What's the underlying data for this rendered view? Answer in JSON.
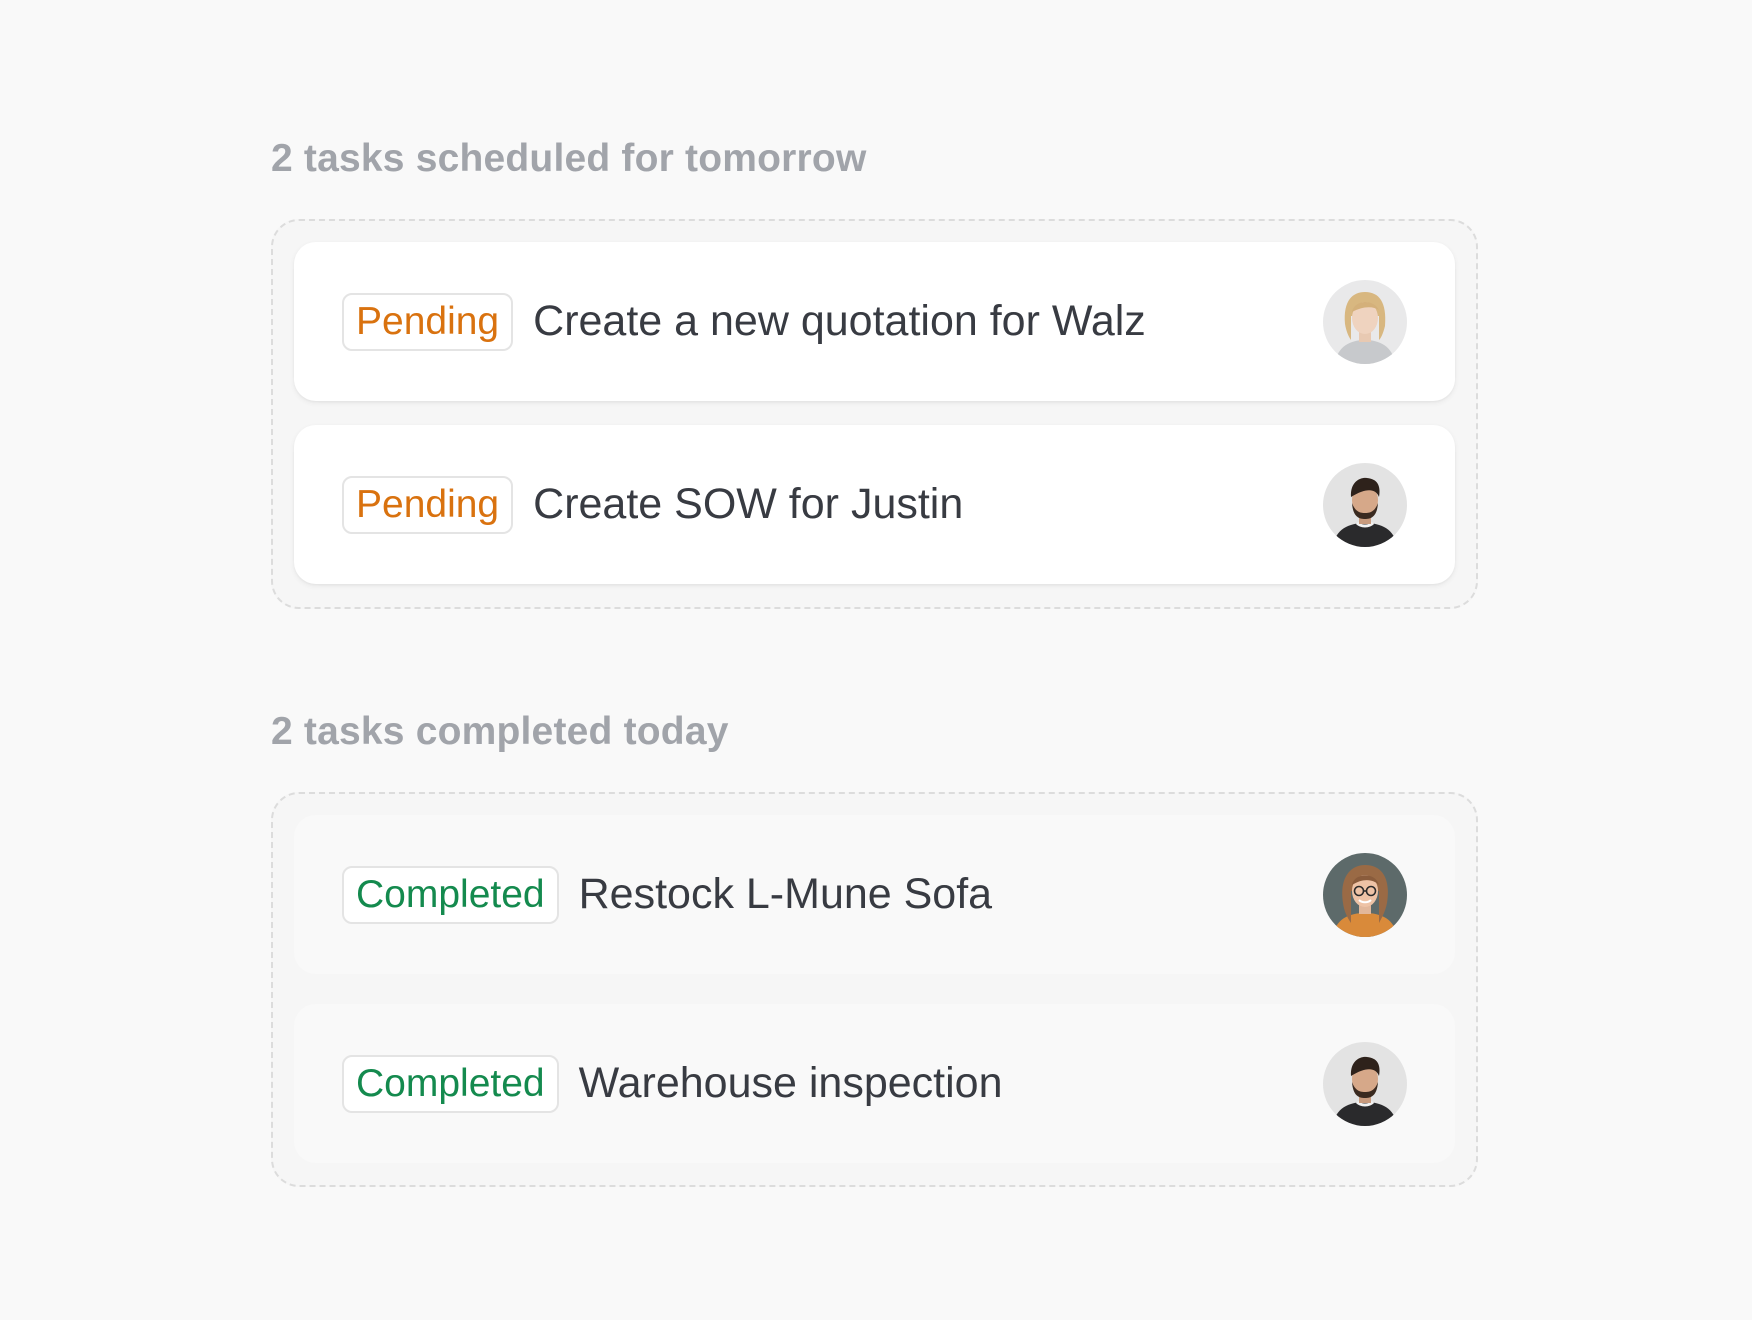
{
  "sections": [
    {
      "title": "2 tasks scheduled for tomorrow",
      "tasks": [
        {
          "status": "Pending",
          "title": "Create a new quotation for Walz",
          "avatar": "avatar-blonde-woman"
        },
        {
          "status": "Pending",
          "title": "Create SOW for Justin",
          "avatar": "avatar-bearded-man"
        }
      ]
    },
    {
      "title": "2 tasks completed today",
      "tasks": [
        {
          "status": "Completed",
          "title": "Restock L-Mune Sofa",
          "avatar": "avatar-woman-glasses"
        },
        {
          "status": "Completed",
          "title": "Warehouse inspection",
          "avatar": "avatar-bearded-man"
        }
      ]
    }
  ],
  "colors": {
    "pending": "#d9720f",
    "completed": "#148a4e",
    "section_title": "#a1a4aa",
    "task_text": "#383b42"
  }
}
